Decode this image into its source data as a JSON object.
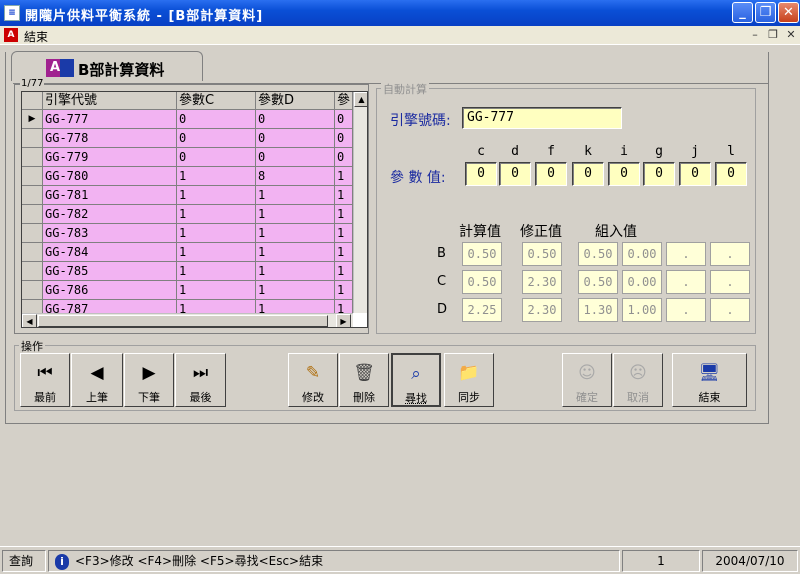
{
  "window": {
    "title": "開隴片供料平衡系統 - [B部計算資料]",
    "buttons": {
      "minimize": "_",
      "restore": "❐",
      "close": "✕"
    }
  },
  "menu": {
    "exit": "結束"
  },
  "tab": {
    "label": "B部計算資料"
  },
  "grid": {
    "record_count": "1/77",
    "columns": [
      "引擎代號",
      "參數C",
      "參數D",
      "參"
    ],
    "rows": [
      [
        "GG-777",
        "0",
        "0",
        "0"
      ],
      [
        "GG-778",
        "0",
        "0",
        "0"
      ],
      [
        "GG-779",
        "0",
        "0",
        "0"
      ],
      [
        "GG-780",
        "1",
        "8",
        "1"
      ],
      [
        "GG-781",
        "1",
        "1",
        "1"
      ],
      [
        "GG-782",
        "1",
        "1",
        "1"
      ],
      [
        "GG-783",
        "1",
        "1",
        "1"
      ],
      [
        "GG-784",
        "1",
        "1",
        "1"
      ],
      [
        "GG-785",
        "1",
        "1",
        "1"
      ],
      [
        "GG-786",
        "1",
        "1",
        "1"
      ],
      [
        "GG-787",
        "1",
        "1",
        "1"
      ]
    ]
  },
  "auto": {
    "group_label": "自動計算",
    "engine_label": "引擎號碼:",
    "engine_value": "GG-777",
    "param_label": "參 數 值:",
    "param_names": [
      "c",
      "d",
      "f",
      "k",
      "i",
      "g",
      "j",
      "l"
    ],
    "param_values": [
      "0",
      "0",
      "0",
      "0",
      "0",
      "0",
      "0",
      "0"
    ],
    "col_calc": "計算值",
    "col_fix": "修正值",
    "col_group": "組入值",
    "rows": [
      {
        "label": "B",
        "values": [
          "0.50",
          "0.50",
          "0.50",
          "0.00",
          ".",
          "."
        ]
      },
      {
        "label": "C",
        "values": [
          "0.50",
          "2.30",
          "0.50",
          "0.00",
          ".",
          "."
        ]
      },
      {
        "label": "D",
        "values": [
          "2.25",
          "2.30",
          "1.30",
          "1.00",
          ".",
          "."
        ]
      }
    ]
  },
  "ops": {
    "group_label": "操作",
    "first": "最前",
    "prev": "上筆",
    "next": "下筆",
    "last": "最後",
    "edit": "修改",
    "delete": "刪除",
    "find": "尋找",
    "sync": "同步",
    "confirm": "確定",
    "cancel": "取消",
    "exit": "結束"
  },
  "status": {
    "mode": "查詢",
    "hint": "<F3>修改 <F4>刪除 <F5>尋找<Esc>結束",
    "number": "1",
    "date": "2004/07/10"
  },
  "colors": {
    "row_bg": "#f2b3f2",
    "field_bg": "#ffffc0",
    "title_blue": "#0a4fd6"
  }
}
